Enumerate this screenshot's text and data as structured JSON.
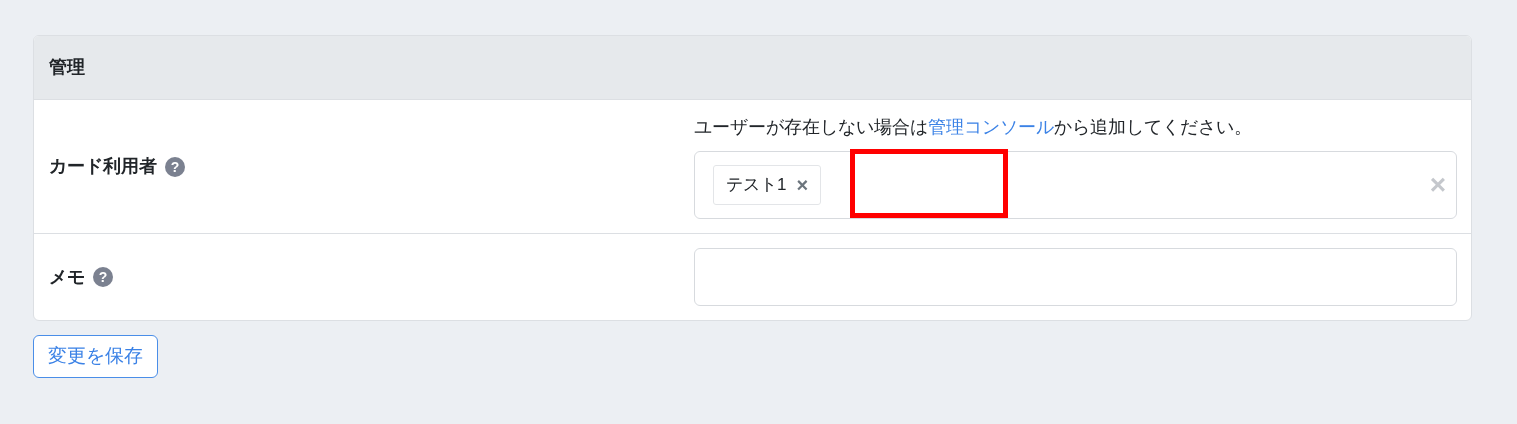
{
  "card": {
    "title": "管理",
    "fields": [
      {
        "kind": "multiselect",
        "label": "カード利用者",
        "help": "?",
        "hint": {
          "before": "ユーザーが存在しない場合は",
          "link": "管理コンソール",
          "after": "から追加してください。"
        },
        "tags": [
          {
            "text": "テスト1",
            "remove": "×"
          }
        ],
        "clear": "×",
        "annotations": [
          {
            "kind": "rectangle"
          }
        ]
      },
      {
        "kind": "text",
        "label": "メモ",
        "help": "?"
      }
    ]
  },
  "save_button": "変更を保存"
}
